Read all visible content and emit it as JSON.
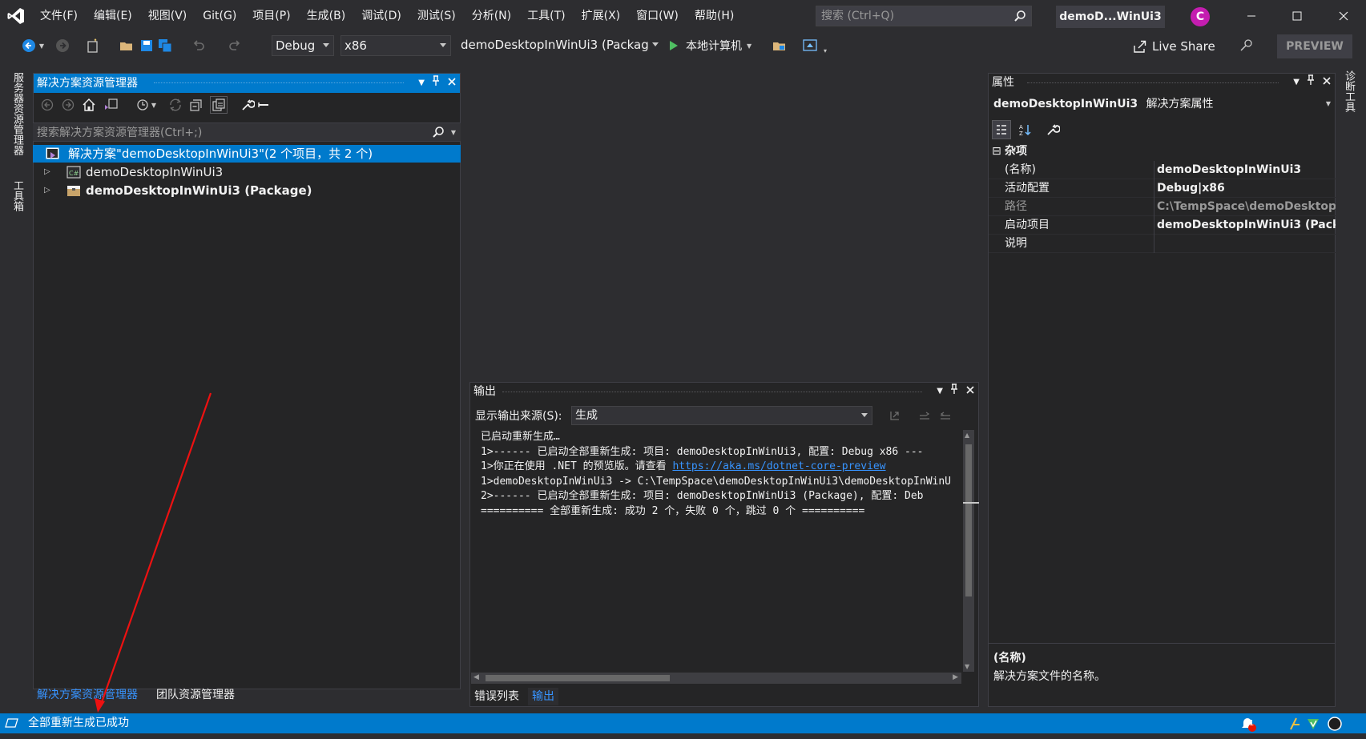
{
  "menu": {
    "items": [
      "文件(F)",
      "编辑(E)",
      "视图(V)",
      "Git(G)",
      "项目(P)",
      "生成(B)",
      "调试(D)",
      "测试(S)",
      "分析(N)",
      "工具(T)",
      "扩展(X)",
      "窗口(W)",
      "帮助(H)"
    ],
    "search_placeholder": "搜索 (Ctrl+Q)",
    "solution_name": "demoD...WinUi3",
    "avatar_letter": "C"
  },
  "toolbar": {
    "config": "Debug",
    "platform": "x86",
    "startup_project": "demoDesktopInWinUi3 (Packag",
    "run_target": "本地计算机",
    "live_share": "Live Share",
    "preview": "PREVIEW"
  },
  "side_tabs": {
    "server_explorer": "服务器资源管理器",
    "toolbox": "工具箱",
    "diagnostics": "诊断工具"
  },
  "solution_explorer": {
    "title": "解决方案资源管理器",
    "search_placeholder": "搜索解决方案资源管理器(Ctrl+;)",
    "tree": [
      {
        "label": "解决方案\"demoDesktopInWinUi3\"(2 个项目，共 2 个)",
        "selected": true
      },
      {
        "label": "demoDesktopInWinUi3",
        "selected": false
      },
      {
        "label": "demoDesktopInWinUi3 (Package)",
        "selected": false
      }
    ],
    "bottom_tabs": [
      "解决方案资源管理器",
      "团队资源管理器"
    ]
  },
  "properties": {
    "title": "属性",
    "object_name": "demoDesktopInWinUi3",
    "object_type": "解决方案属性",
    "category": "杂项",
    "rows": [
      {
        "name": "(名称)",
        "value": "demoDesktopInWinUi3"
      },
      {
        "name": "活动配置",
        "value": "Debug|x86"
      },
      {
        "name": "路径",
        "value": "C:\\TempSpace\\demoDesktop"
      },
      {
        "name": "启动项目",
        "value": "demoDesktopInWinUi3 (Pack"
      },
      {
        "name": "说明",
        "value": ""
      }
    ],
    "desc_title": "(名称)",
    "desc_text": "解决方案文件的名称。"
  },
  "output": {
    "title": "输出",
    "source_label": "显示输出来源(S):",
    "source_value": "生成",
    "lines": [
      "已启动重新生成…",
      "1>------ 已启动全部重新生成: 项目: demoDesktopInWinUi3, 配置: Debug x86 ---",
      "1>你正在使用 .NET 的预览版。请查看 ",
      "1>demoDesktopInWinUi3 -> C:\\TempSpace\\demoDesktopInWinUi3\\demoDesktopInWinU",
      "2>------ 已启动全部重新生成: 项目: demoDesktopInWinUi3 (Package), 配置: Deb",
      "========== 全部重新生成: 成功 2 个，失败 0 个，跳过 0 个 =========="
    ],
    "link": "https://aka.ms/dotnet-core-preview",
    "bottom_tabs": [
      "错误列表",
      "输出"
    ]
  },
  "status": {
    "text": "全部重新生成已成功",
    "notification_count": "1"
  }
}
